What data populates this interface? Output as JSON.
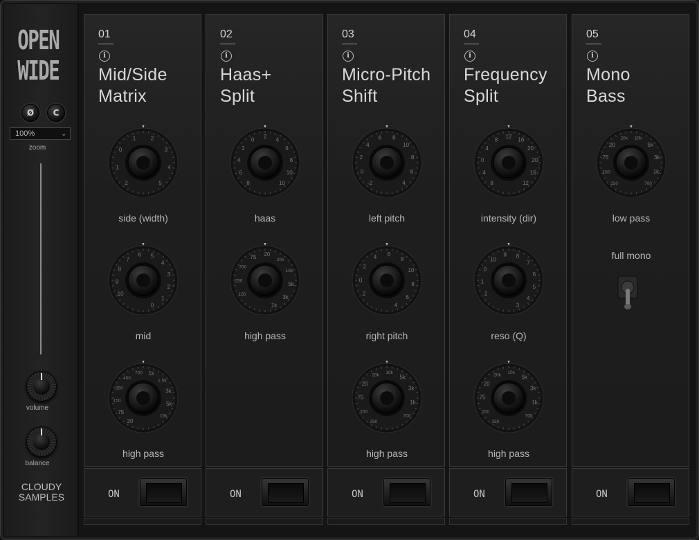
{
  "app": {
    "logo_line1": "OPEN",
    "logo_line2": "WIDE",
    "phase_button": "Ø",
    "c_button": "C",
    "zoom_value": "100%",
    "zoom_label": "zoom",
    "volume_label": "volume",
    "balance_label": "balance",
    "brand_line1": "CLOUDY",
    "brand_line2": "SAMPLES"
  },
  "modules": [
    {
      "number": "01",
      "title_line1": "Mid/Side",
      "title_line2": "Matrix",
      "on_label": "ON",
      "knobs": [
        {
          "label": "side (width)",
          "ticks": [
            "2",
            "1",
            "0",
            "1",
            "2",
            "3",
            "4",
            "5"
          ]
        },
        {
          "label": "mid",
          "ticks": [
            "10",
            "9",
            "8",
            "7",
            "6",
            "5",
            "4",
            "3",
            "2",
            "1",
            "0"
          ]
        },
        {
          "label": "high pass",
          "ticks": [
            "20",
            "75",
            "150",
            "250",
            "400",
            "700",
            "1k",
            "1.5k",
            "3k",
            "5k",
            "10k"
          ]
        }
      ]
    },
    {
      "number": "02",
      "title_line1": "Haas+",
      "title_line2": "Split",
      "on_label": "ON",
      "knobs": [
        {
          "label": "haas",
          "ticks": [
            "8",
            "6",
            "4",
            "2",
            "0",
            "2",
            "4",
            "6",
            "8",
            "10",
            "10"
          ]
        },
        {
          "label": "high pass",
          "ticks": [
            "150",
            "250",
            "700",
            "75",
            "20",
            "20k",
            "10k",
            "5k",
            "3k",
            "1k"
          ]
        }
      ]
    },
    {
      "number": "03",
      "title_line1": "Micro-Pitch",
      "title_line2": "Shift",
      "on_label": "ON",
      "knobs": [
        {
          "label": "left pitch",
          "ticks": [
            "-2",
            "0",
            "2",
            "4",
            "6",
            "8",
            "10",
            "8",
            "6",
            "4"
          ]
        },
        {
          "label": "right pitch",
          "ticks": [
            "2",
            "0",
            "2",
            "4",
            "6",
            "8",
            "10",
            "8",
            "6",
            "4"
          ]
        },
        {
          "label": "high pass",
          "ticks": [
            "250",
            "150",
            "75",
            "20",
            "20k",
            "10k",
            "5k",
            "3k",
            "1k",
            "700"
          ]
        }
      ]
    },
    {
      "number": "04",
      "title_line1": "Frequency",
      "title_line2": "Split",
      "on_label": "ON",
      "knobs": [
        {
          "label": "intensity (dir)",
          "ticks": [
            "8",
            "4",
            "0",
            "4",
            "8",
            "12",
            "16",
            "20",
            "20",
            "16",
            "12"
          ]
        },
        {
          "label": "reso (Q)",
          "ticks": [
            "2",
            "1",
            "0",
            "10",
            "9",
            "8",
            "7",
            "6",
            "5",
            "4",
            "3"
          ]
        },
        {
          "label": "high pass",
          "ticks": [
            "250",
            "150",
            "75",
            "20",
            "20k",
            "10k",
            "5k",
            "3k",
            "1k",
            "700"
          ]
        }
      ]
    },
    {
      "number": "05",
      "title_line1": "Mono",
      "title_line2": "Bass",
      "on_label": "ON",
      "knobs": [
        {
          "label": "low pass",
          "ticks": [
            "250",
            "150",
            "75",
            "20",
            "20k",
            "10k",
            "5k",
            "3k",
            "1k",
            "700"
          ]
        }
      ],
      "toggle_label": "full mono"
    }
  ]
}
